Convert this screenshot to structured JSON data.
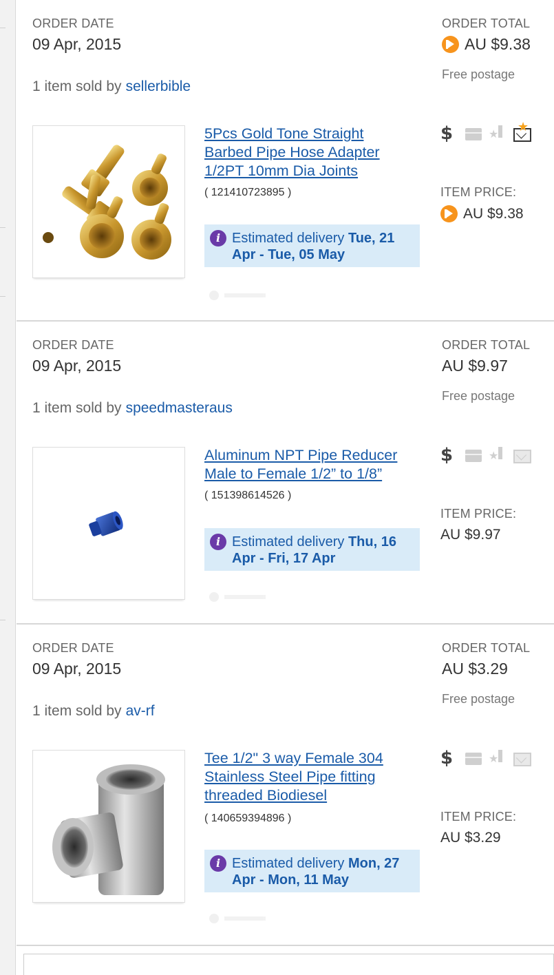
{
  "orders": [
    {
      "order_date_label": "ORDER DATE",
      "order_date": "09 Apr, 2015",
      "sold_by_prefix": "1 item sold by",
      "seller": "sellerbible",
      "order_total_label": "ORDER TOTAL",
      "order_total": "AU $9.38",
      "postage": "Free postage",
      "item_title": "5Pcs Gold Tone Straight Barbed Pipe Hose Adapter 1/2PT 10mm Dia Joints",
      "item_id": "( 121410723895 )",
      "item_price_label": "ITEM PRICE:",
      "item_price": "AU $9.38",
      "delivery_prefix": "Estimated delivery",
      "delivery_dates": "Tue, 21 Apr - Tue, 05 May",
      "paypal_badge": true,
      "feedback_icon": "mail-star-icon"
    },
    {
      "order_date_label": "ORDER DATE",
      "order_date": "09 Apr, 2015",
      "sold_by_prefix": "1 item sold by",
      "seller": "speedmasteraus",
      "order_total_label": "ORDER TOTAL",
      "order_total": "AU $9.97",
      "postage": "Free postage",
      "item_title": "Aluminum NPT Pipe Reducer Male to Female 1/2” to 1/8”",
      "item_id": "( 151398614526 )",
      "item_price_label": "ITEM PRICE:",
      "item_price": "AU $9.97",
      "delivery_prefix": "Estimated delivery",
      "delivery_dates": "Thu, 16 Apr - Fri, 17 Apr",
      "paypal_badge": false,
      "feedback_icon": "mail-icon"
    },
    {
      "order_date_label": "ORDER DATE",
      "order_date": "09 Apr, 2015",
      "sold_by_prefix": "1 item sold by",
      "seller": "av-rf",
      "order_total_label": "ORDER TOTAL",
      "order_total": "AU $3.29",
      "postage": "Free postage",
      "item_title": "Tee 1/2\" 3 way Female 304 Stainless Steel Pipe fitting threaded Biodiesel",
      "item_id": "( 140659394896 )",
      "item_price_label": "ITEM PRICE:",
      "item_price": "AU $3.29",
      "delivery_prefix": "Estimated delivery",
      "delivery_dates": "Mon, 27 Apr - Mon, 11 May",
      "paypal_badge": false,
      "feedback_icon": "mail-icon"
    }
  ],
  "status_icons": [
    "dollar-icon",
    "package-icon",
    "star-feedback-icon",
    "envelope-icon"
  ],
  "colors": {
    "link": "#1a5ba8",
    "delivery_bg": "#d9ebf8",
    "info_icon": "#6a3aa8",
    "paypal": "#f7941d",
    "divider": "#d7d7d7"
  }
}
